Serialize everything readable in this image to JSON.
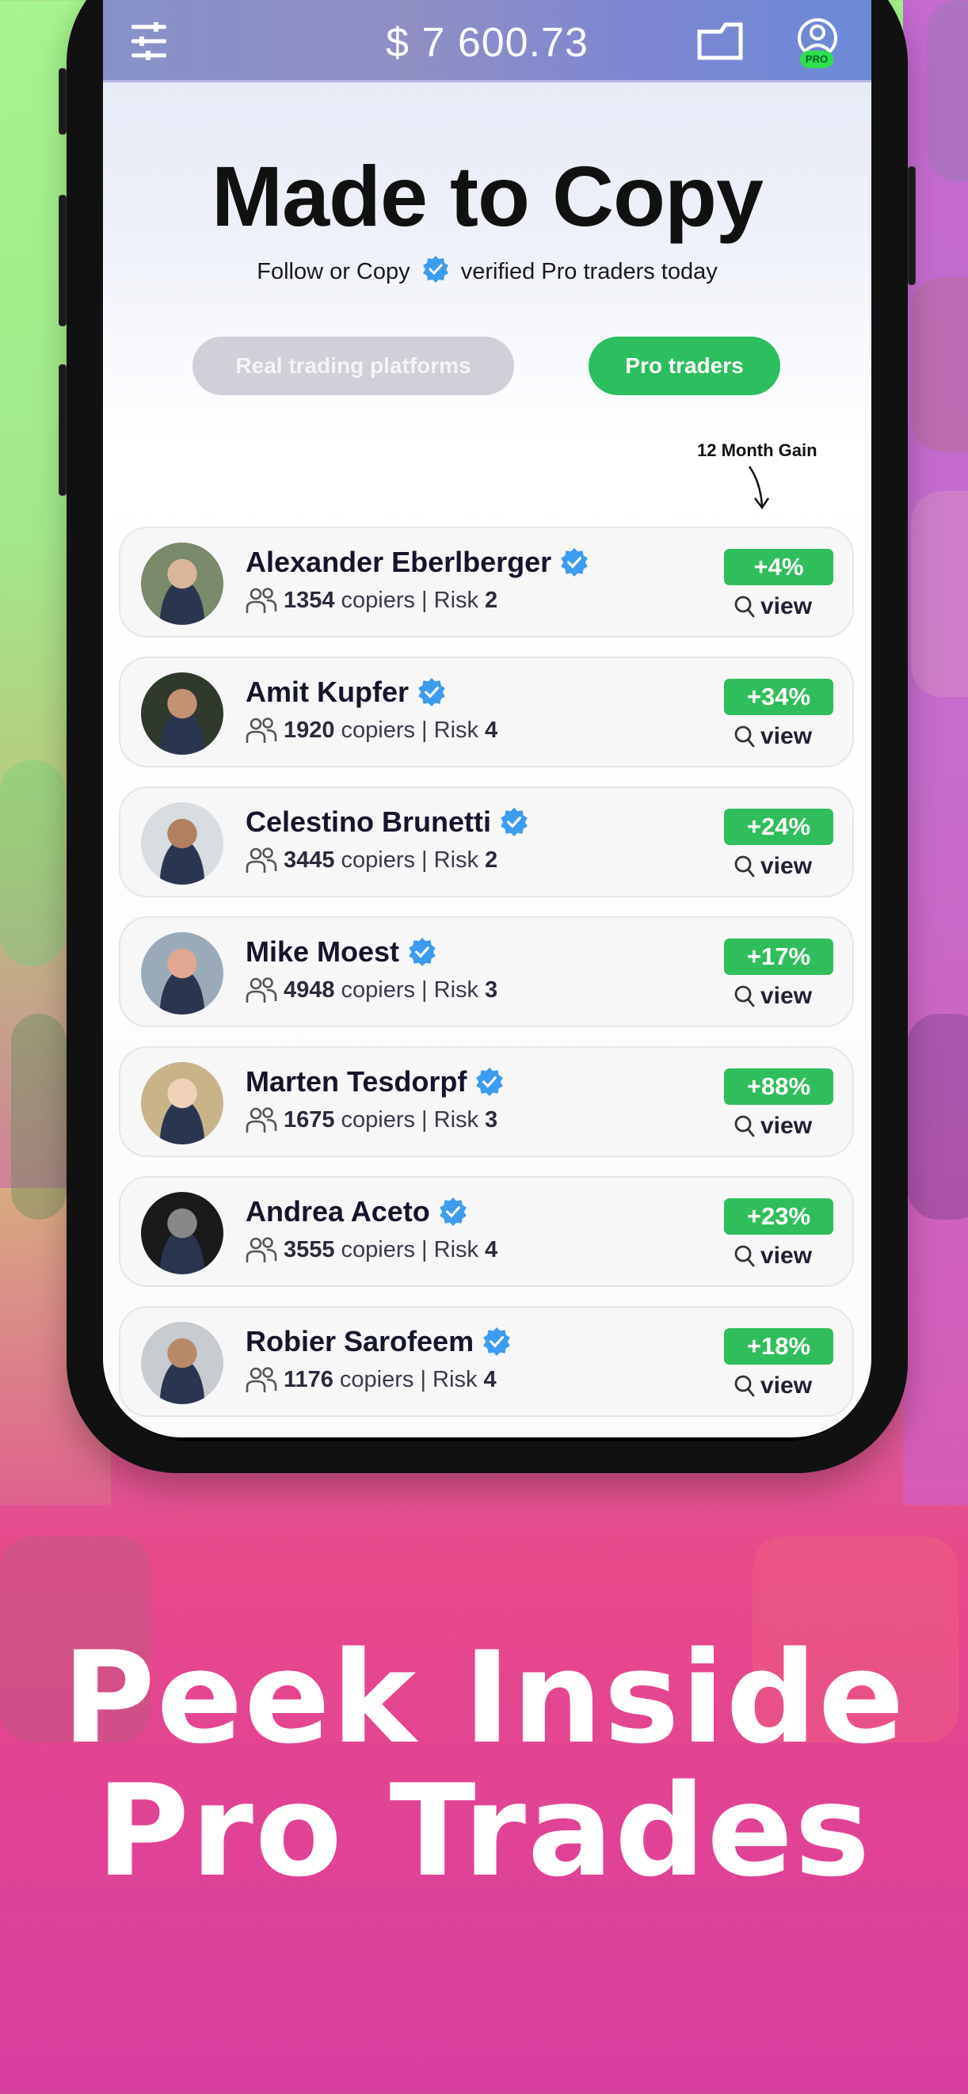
{
  "topbar": {
    "filter_icon": "sliders-icon",
    "balance": "$ 7 600.73",
    "folder_icon": "folder-icon",
    "profile_icon": "user-circle-icon",
    "pro_badge": "PRO"
  },
  "hero": {
    "title": "Made to Copy",
    "subtitle_before": "Follow or Copy",
    "subtitle_after": "verified Pro traders today",
    "verified_icon": "verified-badge-icon"
  },
  "tabs": [
    {
      "label": "Real trading platforms",
      "active": false
    },
    {
      "label": "Pro traders",
      "active": true
    }
  ],
  "gain_header": "12 Month Gain",
  "traders": [
    {
      "name": "Alexander Eberlberger",
      "copiers": "1354",
      "copiers_label": "copiers | Risk",
      "risk": "2",
      "gain": "+4%",
      "view": "view"
    },
    {
      "name": "Amit Kupfer",
      "copiers": "1920",
      "copiers_label": "copiers | Risk",
      "risk": "4",
      "gain": "+34%",
      "view": "view"
    },
    {
      "name": "Celestino Brunetti",
      "copiers": "3445",
      "copiers_label": "copiers | Risk",
      "risk": "2",
      "gain": "+24%",
      "view": "view"
    },
    {
      "name": "Mike Moest",
      "copiers": "4948",
      "copiers_label": "copiers | Risk",
      "risk": "3",
      "gain": "+17%",
      "view": "view"
    },
    {
      "name": "Marten Tesdorpf",
      "copiers": "1675",
      "copiers_label": "copiers | Risk",
      "risk": "3",
      "gain": "+88%",
      "view": "view"
    },
    {
      "name": "Andrea Aceto",
      "copiers": "3555",
      "copiers_label": "copiers | Risk",
      "risk": "4",
      "gain": "+23%",
      "view": "view"
    },
    {
      "name": "Robier Sarofeem",
      "copiers": "1176",
      "copiers_label": "copiers | Risk",
      "risk": "4",
      "gain": "+18%",
      "view": "view"
    }
  ],
  "colors": {
    "accent_green": "#2fbe5b",
    "verified_blue": "#3d9bf0",
    "inactive_tab": "#cfd0d8"
  },
  "promo": {
    "line1": "Peek Inside",
    "line2": "Pro Trades"
  }
}
